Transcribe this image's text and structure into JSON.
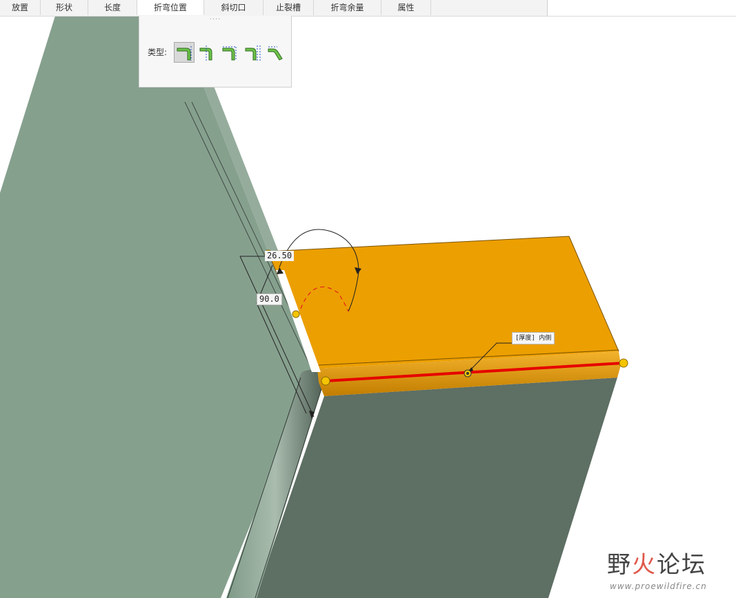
{
  "tabs": [
    {
      "label": "放置"
    },
    {
      "label": "形状"
    },
    {
      "label": "长度"
    },
    {
      "label": "折弯位置"
    },
    {
      "label": "斜切口"
    },
    {
      "label": "止裂槽"
    },
    {
      "label": "折弯余量"
    },
    {
      "label": "属性"
    }
  ],
  "active_tab": "折弯位置",
  "panel": {
    "grip": "····",
    "type_label": "类型:",
    "type_options": [
      {
        "icon": "bend-outside-icon",
        "selected": true
      },
      {
        "icon": "bend-inside-icon",
        "selected": false
      },
      {
        "icon": "bend-tangent-icon",
        "selected": false
      },
      {
        "icon": "bend-offset-icon",
        "selected": false
      },
      {
        "icon": "bend-joggle-icon",
        "selected": false
      }
    ]
  },
  "dimensions": {
    "length": "26.50",
    "angle": "90.0"
  },
  "note": "[厚度] 内侧",
  "watermark": {
    "title_1": "野",
    "title_2": "火",
    "title_3": "论坛",
    "url": "www.proewildfire.cn"
  },
  "colors": {
    "flange": "#EC9F00",
    "base_left": "#86A08E",
    "base_right": "#5E6F64",
    "edge_highlight": "#E60000",
    "handle": "#F5C400"
  }
}
